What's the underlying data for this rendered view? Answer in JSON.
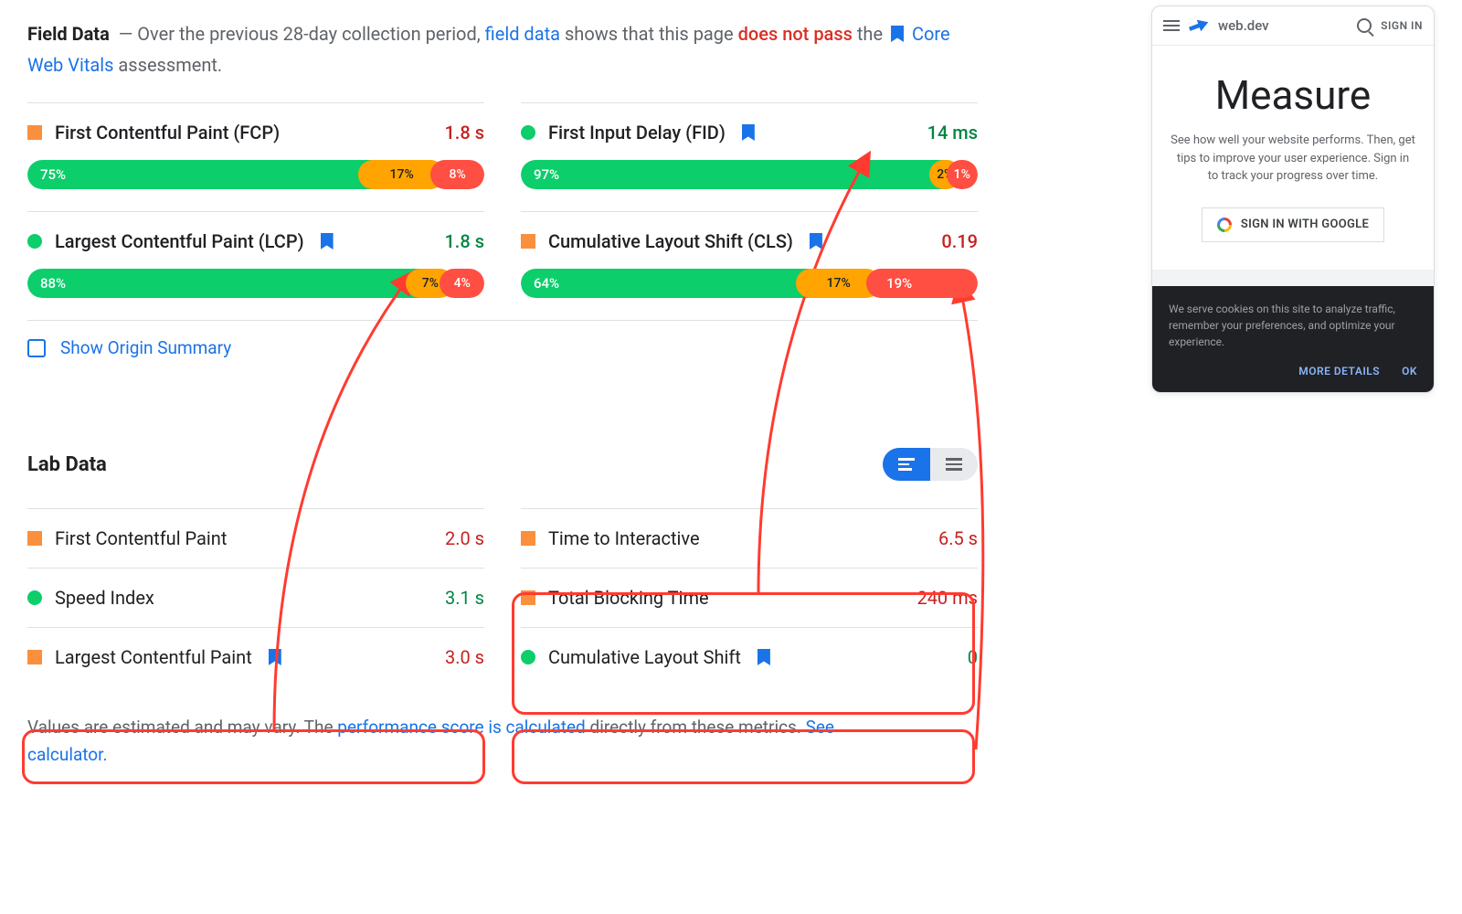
{
  "fieldData": {
    "titleStrong": "Field Data",
    "dash": "—",
    "preText": "Over the previous 28-day collection period,",
    "fieldDataLink": "field data",
    "midText": "shows that this page",
    "failText": "does not pass",
    "theText": "the",
    "cwvLink": "Core Web Vitals",
    "assessment": "assessment."
  },
  "metrics": {
    "fcp": {
      "name": "First Contentful Paint (FCP)",
      "value": "1.8 s",
      "dist": {
        "good": "75%",
        "ni": "17%",
        "poor": "8%"
      }
    },
    "fid": {
      "name": "First Input Delay (FID)",
      "value": "14 ms",
      "dist": {
        "good": "97%",
        "ni": "2%",
        "poor": "1%"
      }
    },
    "lcp": {
      "name": "Largest Contentful Paint (LCP)",
      "value": "1.8 s",
      "dist": {
        "good": "88%",
        "ni": "7%",
        "poor": "4%"
      }
    },
    "cls": {
      "name": "Cumulative Layout Shift (CLS)",
      "value": "0.19",
      "dist": {
        "good": "64%",
        "ni": "17%",
        "poor": "19%"
      }
    }
  },
  "showOrigin": "Show Origin Summary",
  "labData": {
    "title": "Lab Data",
    "rows": {
      "fcp": {
        "name": "First Contentful Paint",
        "value": "2.0 s"
      },
      "tti": {
        "name": "Time to Interactive",
        "value": "6.5 s"
      },
      "si": {
        "name": "Speed Index",
        "value": "3.1 s"
      },
      "tbt": {
        "name": "Total Blocking Time",
        "value": "240 ms"
      },
      "lcp": {
        "name": "Largest Contentful Paint",
        "value": "3.0 s"
      },
      "cls": {
        "name": "Cumulative Layout Shift",
        "value": "0"
      }
    }
  },
  "footer": {
    "pre": "Values are estimated and may vary. The",
    "link1": "performance score is calculated",
    "mid": "directly from these metrics.",
    "link2": "See calculator."
  },
  "phone": {
    "brand": "web.dev",
    "signin": "SIGN IN",
    "heading": "Measure",
    "desc": "See how well your website performs. Then, get tips to improve your user experience. Sign in to track your progress over time.",
    "googleBtn": "SIGN IN WITH GOOGLE",
    "cookie": "We serve cookies on this site to analyze traffic, remember your preferences, and optimize your experience.",
    "moreDetails": "MORE DETAILS",
    "ok": "OK"
  }
}
